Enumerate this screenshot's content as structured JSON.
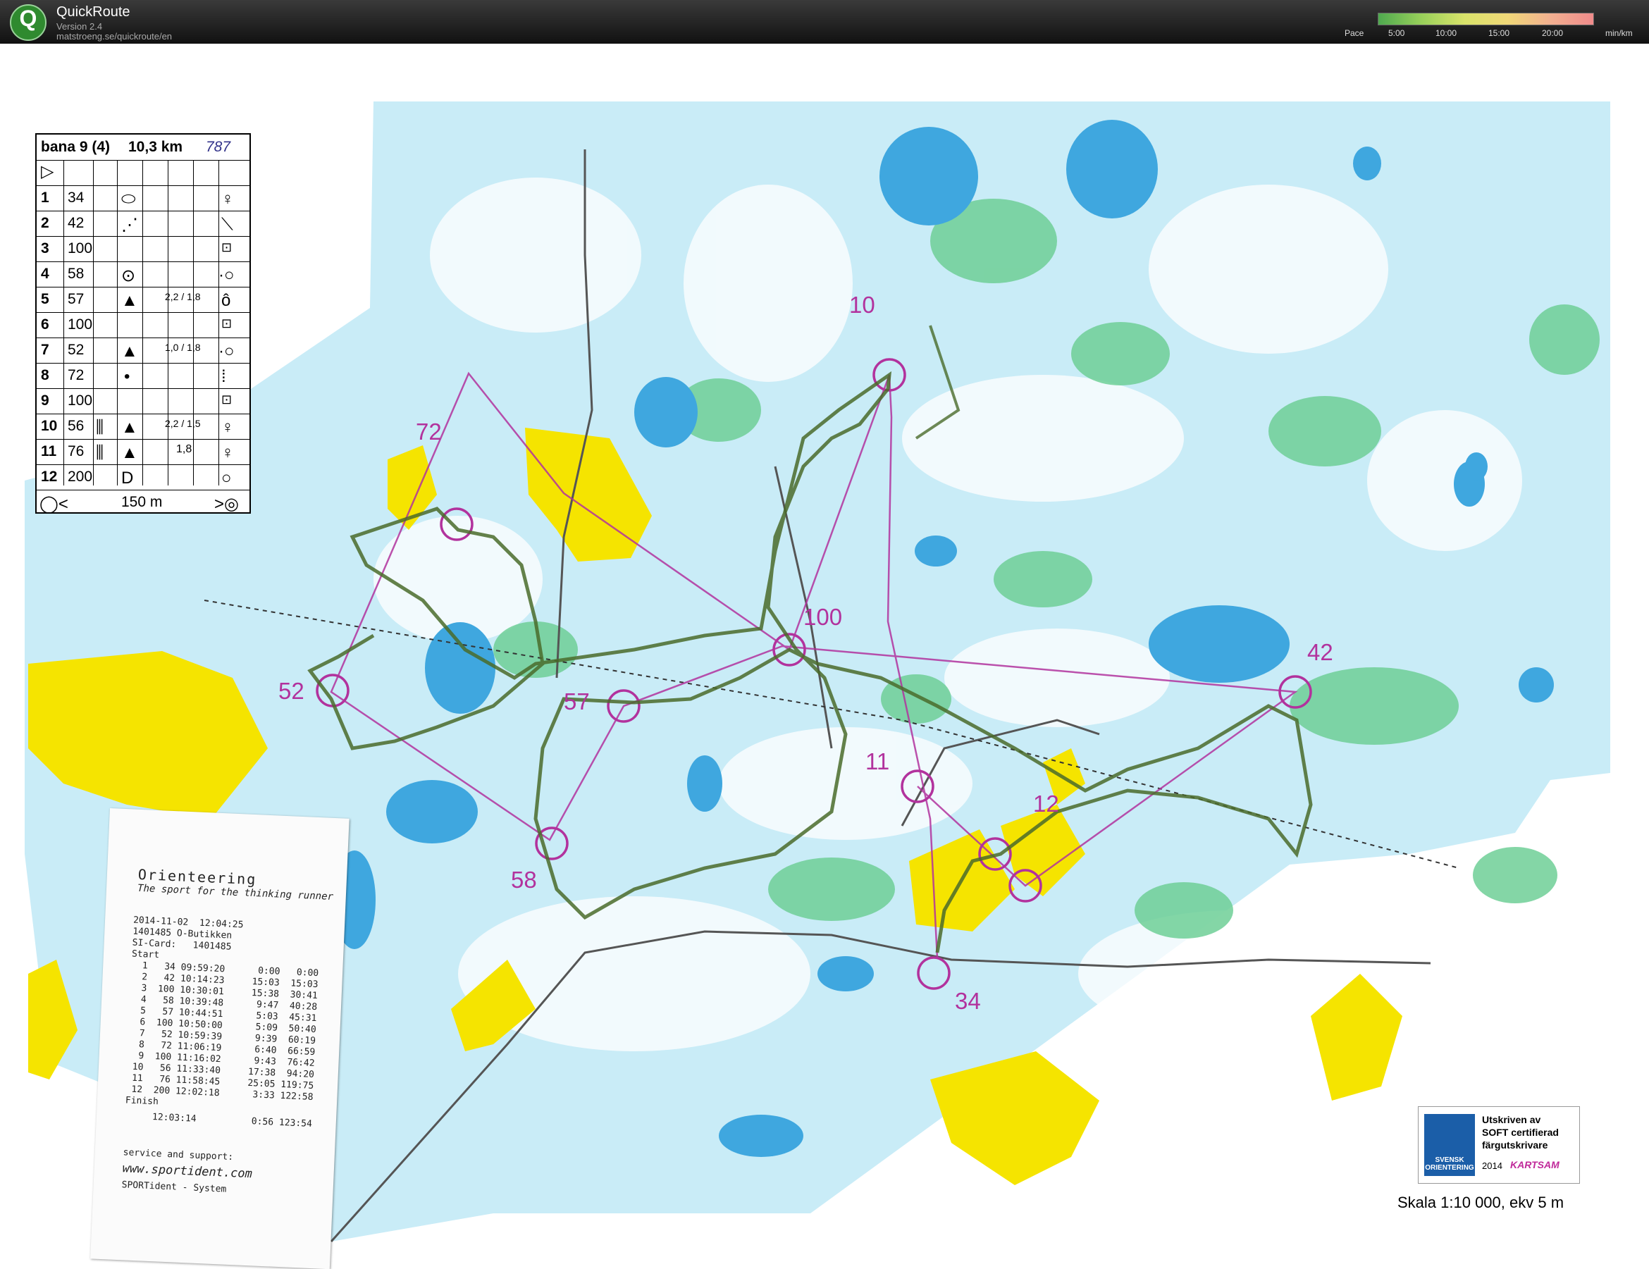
{
  "app": {
    "name": "QuickRoute",
    "version": "Version 2.4",
    "url": "matstroeng.se/quickroute/en"
  },
  "pace_legend": {
    "label": "Pace",
    "ticks": [
      "5:00",
      "10:00",
      "15:00",
      "20:00"
    ],
    "unit": "min/km"
  },
  "course_card": {
    "course": "bana 9 (4)",
    "length": "10,3 km",
    "handwritten": "787",
    "rows": [
      {
        "no": "1",
        "code": "34"
      },
      {
        "no": "2",
        "code": "42"
      },
      {
        "no": "3",
        "code": "100"
      },
      {
        "no": "4",
        "code": "58"
      },
      {
        "no": "5",
        "code": "57",
        "dim": "2,2 / 1,8"
      },
      {
        "no": "6",
        "code": "100"
      },
      {
        "no": "7",
        "code": "52",
        "dim": "1,0 / 1,8"
      },
      {
        "no": "8",
        "code": "72"
      },
      {
        "no": "9",
        "code": "100"
      },
      {
        "no": "10",
        "code": "56",
        "dim": "2,2 / 1,5"
      },
      {
        "no": "11",
        "code": "76",
        "dim": "1,8"
      },
      {
        "no": "12",
        "code": "200"
      }
    ],
    "finish_distance": "150 m"
  },
  "controls": [
    {
      "label": "10"
    },
    {
      "label": "72"
    },
    {
      "label": "100"
    },
    {
      "label": "42"
    },
    {
      "label": "52"
    },
    {
      "label": "57"
    },
    {
      "label": "11"
    },
    {
      "label": "12"
    },
    {
      "label": "58"
    },
    {
      "label": "34"
    }
  ],
  "receipt": {
    "title": "Orienteering",
    "subtitle": "The sport for the thinking runner",
    "lines": [
      "2014-11-02  12:04:25",
      "1401485 O-Butikken",
      "SI-Card:   1401485",
      "Start",
      "  1   34 09:59:20      0:00   0:00",
      "  2   42 10:14:23     15:03  15:03",
      "  3  100 10:30:01     15:38  30:41",
      "  4   58 10:39:48      9:47  40:28",
      "  5   57 10:44:51      5:03  45:31",
      "  6  100 10:50:00      5:09  50:40",
      "  7   52 10:59:39      9:39  60:19",
      "  8   72 11:06:19      6:40  66:59",
      "  9  100 11:16:02      9:43  76:42",
      " 10   56 11:33:40     17:38  94:20",
      " 11   76 11:58:45     25:05 119:75",
      " 12  200 12:02:18      3:33 122:58",
      "Finish",
      "     12:03:14          0:56 123:54"
    ],
    "support": "service and support:",
    "website": "www.sportident.com",
    "system": "SPORTident - System"
  },
  "certificate": {
    "line1": "Utskriven av",
    "line2": "SOFT certifierad",
    "line3": "färgutskrivare",
    "year": "2014",
    "brand": "KARTSAM",
    "logo_text": "SVENSK ORIENTERING"
  },
  "scale": "Skala 1:10 000, ekv 5 m",
  "colors": {
    "course": "#b2329d",
    "route": "#4a6b2a",
    "water": "#3fa7df",
    "open_land": "#f5e400",
    "vegetation": "#6fcf96"
  }
}
